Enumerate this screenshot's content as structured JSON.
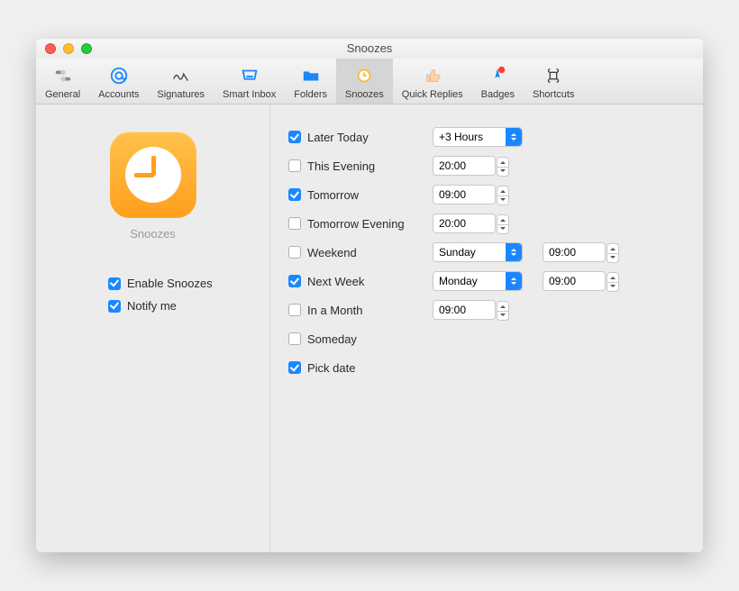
{
  "window": {
    "title": "Snoozes"
  },
  "toolbar": [
    {
      "id": "general",
      "label": "General"
    },
    {
      "id": "accounts",
      "label": "Accounts"
    },
    {
      "id": "signatures",
      "label": "Signatures"
    },
    {
      "id": "smart-inbox",
      "label": "Smart Inbox"
    },
    {
      "id": "folders",
      "label": "Folders"
    },
    {
      "id": "snoozes",
      "label": "Snoozes",
      "selected": true
    },
    {
      "id": "quick-replies",
      "label": "Quick Replies"
    },
    {
      "id": "badges",
      "label": "Badges"
    },
    {
      "id": "shortcuts",
      "label": "Shortcuts"
    }
  ],
  "sidebar": {
    "title": "Snoozes",
    "enable": {
      "label": "Enable Snoozes",
      "checked": true
    },
    "notify": {
      "label": "Notify me",
      "checked": true
    }
  },
  "options": {
    "later_today": {
      "label": "Later Today",
      "checked": true,
      "select": "+3 Hours"
    },
    "this_evening": {
      "label": "This Evening",
      "checked": false,
      "time": "20:00"
    },
    "tomorrow": {
      "label": "Tomorrow",
      "checked": true,
      "time": "09:00"
    },
    "tomorrow_evening": {
      "label": "Tomorrow Evening",
      "checked": false,
      "time": "20:00"
    },
    "weekend": {
      "label": "Weekend",
      "checked": false,
      "select": "Sunday",
      "time": "09:00"
    },
    "next_week": {
      "label": "Next Week",
      "checked": true,
      "select": "Monday",
      "time": "09:00"
    },
    "in_a_month": {
      "label": "In a Month",
      "checked": false,
      "time": "09:00"
    },
    "someday": {
      "label": "Someday",
      "checked": false
    },
    "pick_date": {
      "label": "Pick date",
      "checked": true
    }
  },
  "colors": {
    "accent": "#1b87ff",
    "orange_top": "#ffc14d",
    "orange_bottom": "#ff9f1c"
  }
}
